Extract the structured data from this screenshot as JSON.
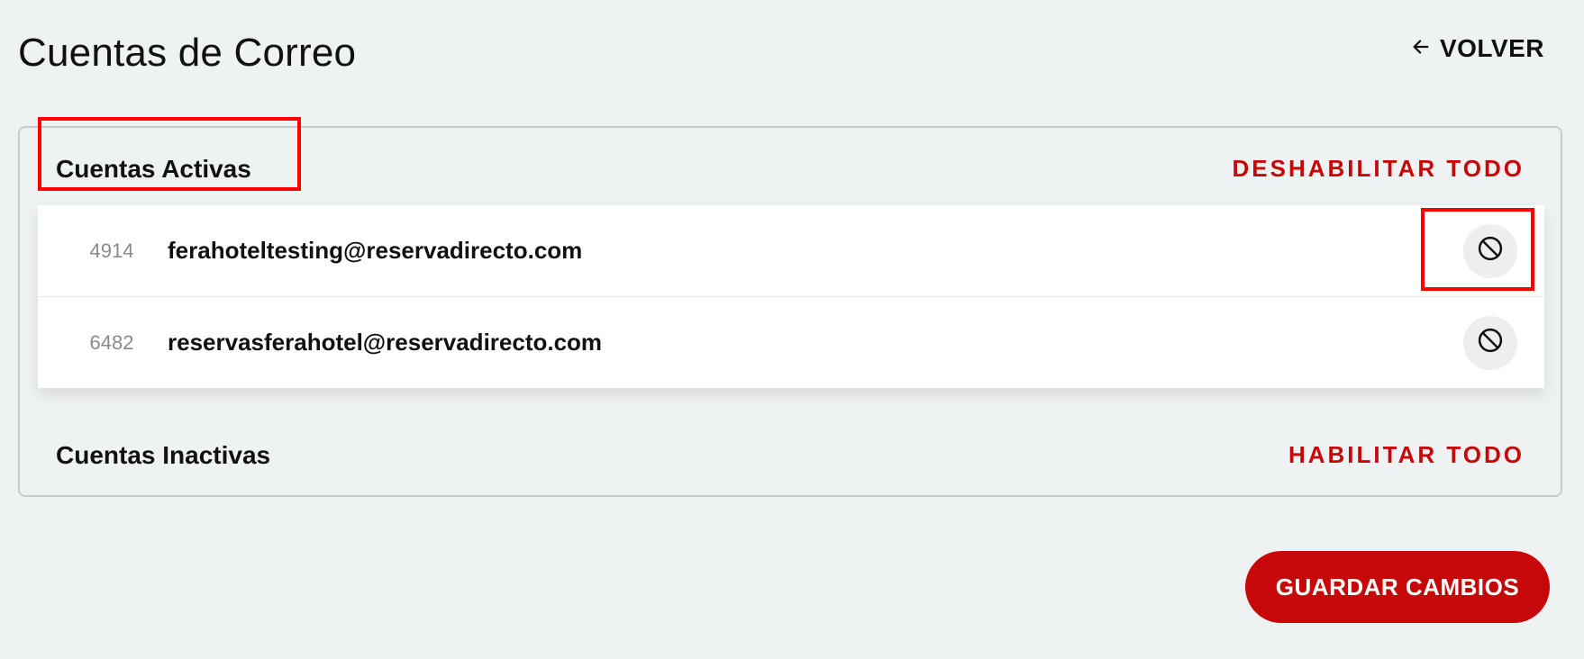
{
  "header": {
    "title": "Cuentas de Correo",
    "back_label": "VOLVER",
    "back_icon": "arrow-left-icon"
  },
  "sections": {
    "active": {
      "title": "Cuentas Activas",
      "action_label": "DESHABILITAR TODO"
    },
    "inactive": {
      "title": "Cuentas Inactivas",
      "action_label": "HABILITAR TODO"
    }
  },
  "active_accounts": [
    {
      "id": "4914",
      "email": "ferahoteltesting@reservadirecto.com",
      "action_icon": "block-icon"
    },
    {
      "id": "6482",
      "email": "reservasferahotel@reservadirecto.com",
      "action_icon": "block-icon"
    }
  ],
  "footer": {
    "save_label": "GUARDAR CAMBIOS"
  },
  "colors": {
    "background": "#eff2f3",
    "accent": "#c70808",
    "highlight": "#ff0000"
  }
}
